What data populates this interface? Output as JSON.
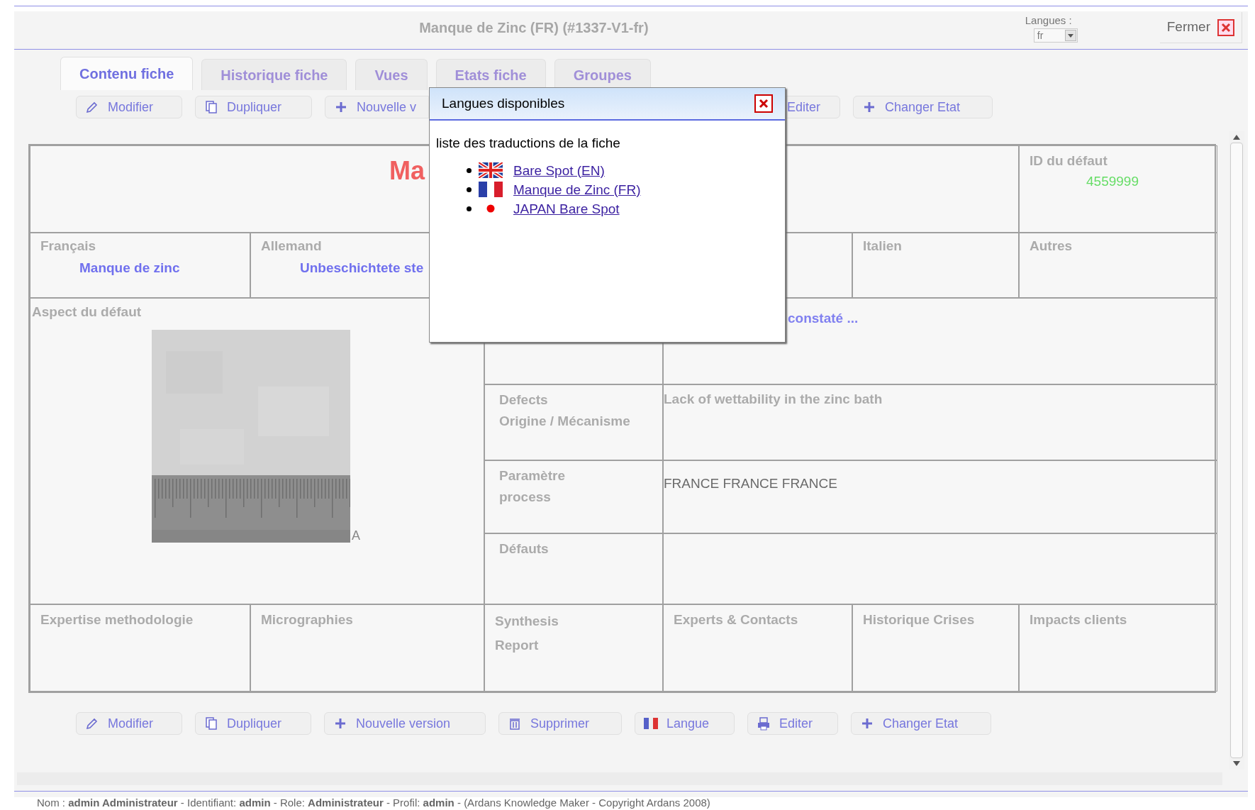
{
  "header": {
    "title": "Manque de Zinc (FR) (#1337-V1-fr)",
    "language_label": "Langues :",
    "language_value": "fr",
    "close_label": "Fermer"
  },
  "tabs": [
    {
      "label": "Contenu fiche",
      "selected": true
    },
    {
      "label": "Historique fiche",
      "selected": false
    },
    {
      "label": "Vues",
      "selected": false
    },
    {
      "label": "Etats fiche",
      "selected": false
    },
    {
      "label": "Groupes",
      "selected": false
    }
  ],
  "top_toolbar": {
    "left": [
      {
        "label": "Modifier",
        "kind": "pencil"
      },
      {
        "label": "Dupliquer",
        "kind": "copy"
      },
      {
        "label": "Nouvelle v",
        "kind": "plus"
      }
    ],
    "right": [
      {
        "label": "Editer",
        "kind": "plain"
      },
      {
        "label": "Changer Etat",
        "kind": "plus"
      }
    ]
  },
  "sheet": {
    "title": "Ma",
    "id_label": "ID du défaut",
    "id_value": "4559999",
    "languages": [
      {
        "label": "Français",
        "value": "Manque de zinc"
      },
      {
        "label": "Allemand",
        "value": "Unbeschichtete ste"
      },
      {
        "label": "Italien"
      },
      {
        "label": "Autres"
      }
    ],
    "aspect_label": "Aspect du défaut",
    "image_suffix": "A",
    "details": [
      {
        "value": "constaté ...",
        "kind": "link"
      },
      {
        "label": "Defects\nOrigine / Mécanisme",
        "value": "Lack of wettability in the zinc bath",
        "kind": "muted"
      },
      {
        "label": "Paramètre\nprocess",
        "value": "FRANCE FRANCE FRANCE",
        "kind": "plain"
      },
      {
        "label": "Défauts"
      }
    ],
    "bottom_cells": [
      "Expertise methodologie",
      "Micrographies",
      "Synthesis\nReport",
      "Experts & Contacts",
      "Historique Crises",
      "Impacts clients"
    ]
  },
  "bottom_toolbar": [
    {
      "label": "Modifier",
      "kind": "pencil"
    },
    {
      "label": "Dupliquer",
      "kind": "copy"
    },
    {
      "label": "Nouvelle version",
      "kind": "plus"
    },
    {
      "label": "Supprimer",
      "kind": "trash"
    },
    {
      "label": "Langue",
      "kind": "flag"
    },
    {
      "label": "Editer",
      "kind": "printer"
    },
    {
      "label": "Changer Etat",
      "kind": "plus"
    }
  ],
  "footer": "Nom : **admin Administrateur** - Identifiant: **admin** - Role: **Administrateur** - Profil: **admin** -  (Ardans Knowledge Maker - Copyright Ardans 2008)",
  "popup": {
    "title": "Langues disponibles",
    "intro": "liste des traductions de la fiche",
    "items": [
      {
        "label": "Bare Spot (EN)",
        "kind": "uk"
      },
      {
        "label": "Manque de Zinc (FR)",
        "kind": "fr"
      },
      {
        "label": "JAPAN Bare Spot",
        "kind": "jp"
      }
    ]
  }
}
